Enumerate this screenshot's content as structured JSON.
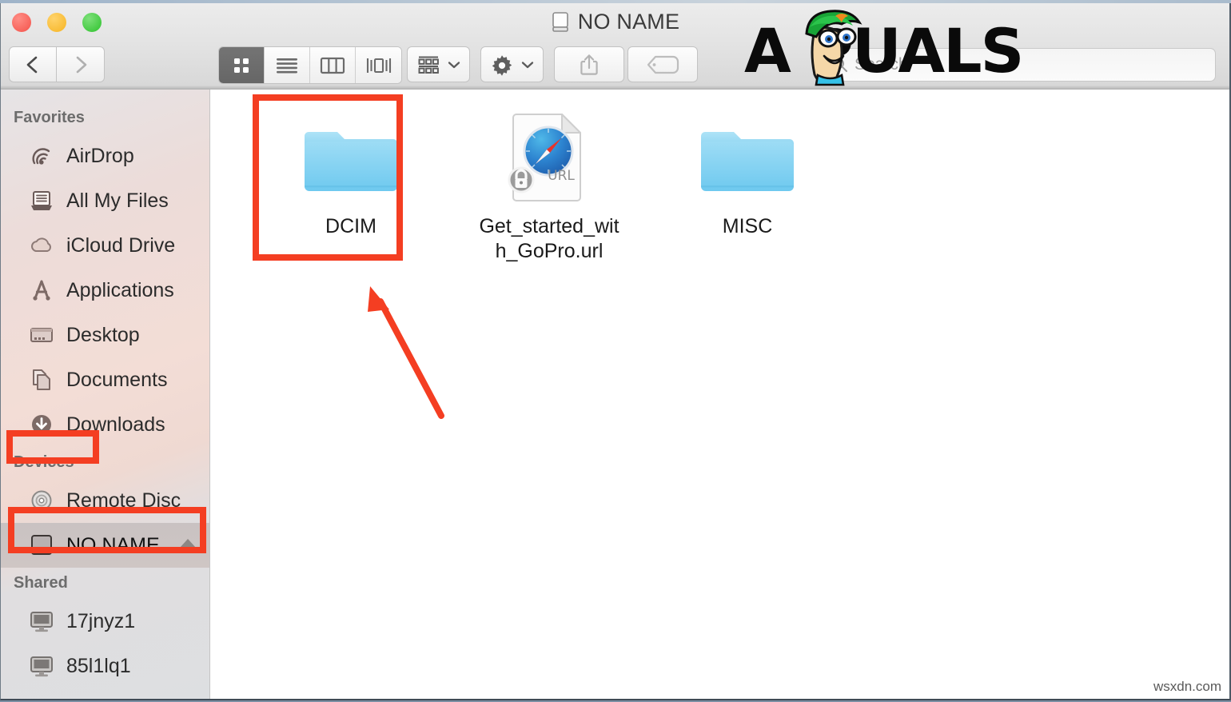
{
  "window": {
    "title": "NO NAME",
    "title_icon": "drive-icon"
  },
  "traffic_lights": {
    "close_label": "close",
    "minimize_label": "minimize",
    "zoom_label": "zoom",
    "close_color": "#f4524a",
    "minimize_color": "#f6b423",
    "zoom_color": "#2dc22c"
  },
  "toolbar": {
    "back_label": "Back",
    "forward_label": "Forward",
    "view_modes": [
      {
        "name": "icon-view",
        "label": "Icon View",
        "active": true
      },
      {
        "name": "list-view",
        "label": "List View",
        "active": false
      },
      {
        "name": "column-view",
        "label": "Column View",
        "active": false
      },
      {
        "name": "coverflow-view",
        "label": "Cover Flow View",
        "active": false
      }
    ],
    "arrange_label": "Arrange By",
    "action_label": "Action",
    "share_label": "Share",
    "tag_label": "Edit Tags"
  },
  "search": {
    "placeholder": "Search",
    "value": "",
    "icon": "search-icon"
  },
  "watermark": {
    "logo_text": "A PUALS",
    "logo_prefix": "A",
    "logo_suffix": "PUALS",
    "bottom_text": "wsxdn.com"
  },
  "sidebar": {
    "sections": [
      {
        "header": "Favorites",
        "items": [
          {
            "label": "AirDrop",
            "icon": "airdrop-icon",
            "selected": false
          },
          {
            "label": "All My Files",
            "icon": "all-my-files-icon",
            "selected": false
          },
          {
            "label": "iCloud Drive",
            "icon": "icloud-icon",
            "selected": false
          },
          {
            "label": "Applications",
            "icon": "applications-icon",
            "selected": false
          },
          {
            "label": "Desktop",
            "icon": "desktop-icon",
            "selected": false
          },
          {
            "label": "Documents",
            "icon": "documents-icon",
            "selected": false
          },
          {
            "label": "Downloads",
            "icon": "downloads-icon",
            "selected": false
          }
        ]
      },
      {
        "header": "Devices",
        "items": [
          {
            "label": "Remote Disc",
            "icon": "disc-icon",
            "selected": false
          },
          {
            "label": "NO NAME",
            "icon": "drive-icon",
            "selected": true,
            "eject": true
          }
        ]
      },
      {
        "header": "Shared",
        "items": [
          {
            "label": "17jnyz1",
            "icon": "computer-icon",
            "selected": false
          },
          {
            "label": "85l1lq1",
            "icon": "computer-icon",
            "selected": false
          }
        ]
      }
    ]
  },
  "content": {
    "files": [
      {
        "name": "DCIM",
        "type": "folder",
        "icon": "folder-icon"
      },
      {
        "name": "Get_started_with_GoPro.url",
        "type": "url",
        "icon": "url-file-icon"
      },
      {
        "name": "MISC",
        "type": "folder",
        "icon": "folder-icon"
      }
    ]
  },
  "annotations": {
    "color": "#f43e22",
    "boxes": [
      {
        "name": "dcim-highlight",
        "target": "DCIM"
      },
      {
        "name": "devices-highlight",
        "target": "Devices"
      },
      {
        "name": "no-name-highlight",
        "target": "NO NAME"
      }
    ],
    "arrow": {
      "name": "pointer-arrow",
      "points_to": "DCIM"
    }
  }
}
